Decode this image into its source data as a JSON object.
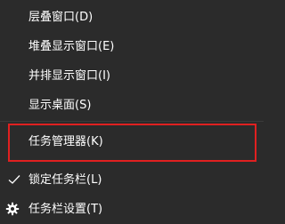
{
  "menu": {
    "items": [
      {
        "label": "层叠窗口(D)"
      },
      {
        "label": "堆叠显示窗口(E)"
      },
      {
        "label": "并排显示窗口(I)"
      },
      {
        "label": "显示桌面(S)"
      },
      {
        "label": "任务管理器(K)"
      },
      {
        "label": "锁定任务栏(L)",
        "icon": "check-icon"
      },
      {
        "label": "任务栏设置(T)",
        "icon": "gear-icon"
      }
    ]
  },
  "colors": {
    "background": "#2b2b2b",
    "text": "#ffffff",
    "highlight_border": "#e02020"
  }
}
